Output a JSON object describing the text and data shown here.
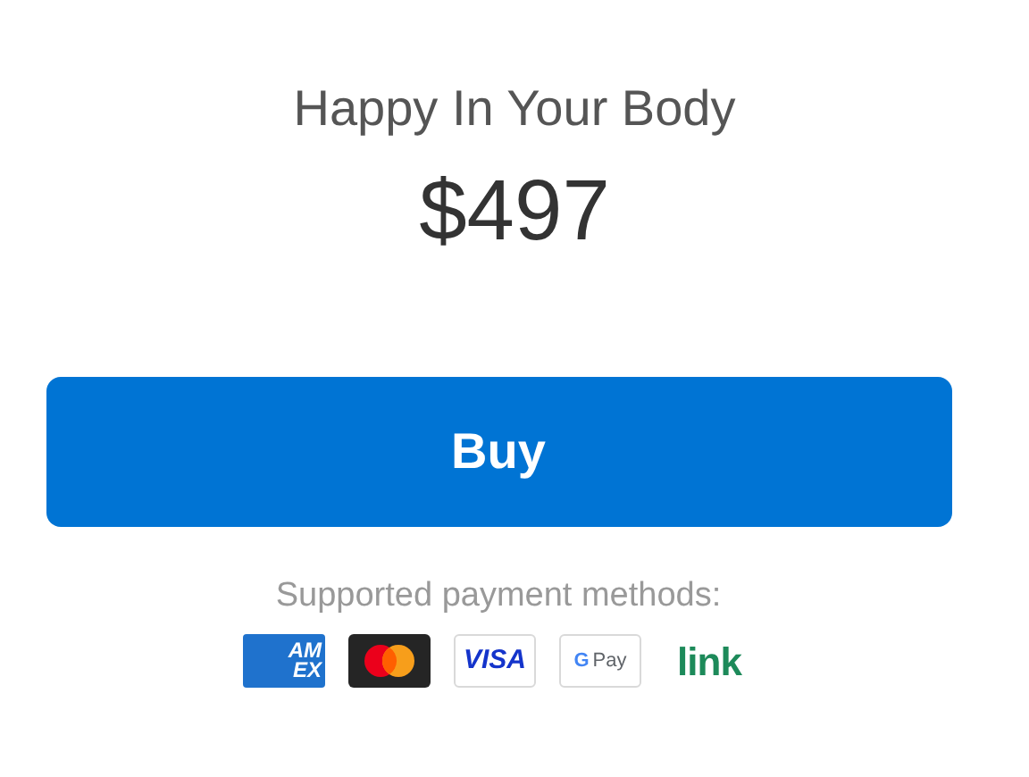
{
  "product": {
    "title": "Happy In Your Body",
    "price": "$497"
  },
  "buy_button": {
    "label": "Buy"
  },
  "payment": {
    "caption": "Supported payment methods:",
    "methods": [
      {
        "kind": "amex",
        "lines": [
          "AM",
          "EX"
        ]
      },
      {
        "kind": "mastercard"
      },
      {
        "kind": "visa",
        "label": "VISA"
      },
      {
        "kind": "gpay",
        "mark": "G",
        "label": "Pay"
      },
      {
        "kind": "link",
        "label": "link"
      }
    ]
  }
}
